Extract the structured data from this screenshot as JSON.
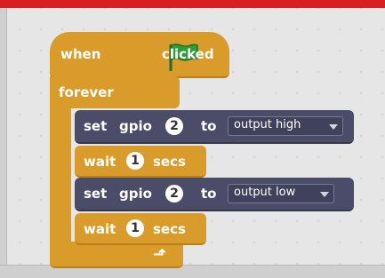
{
  "script": {
    "hat": {
      "when_label": "when",
      "clicked_label": "clicked",
      "flag_icon": "green-flag-icon"
    },
    "forever": {
      "label": "forever",
      "loop_icon": "loop-arrow-icon"
    },
    "blocks": [
      {
        "type": "set_gpio",
        "set_label": "set",
        "gpio_label": "gpio",
        "pin": "2",
        "to_label": "to",
        "mode": "output high"
      },
      {
        "type": "wait",
        "wait_label": "wait",
        "seconds": "1",
        "secs_label": "secs"
      },
      {
        "type": "set_gpio",
        "set_label": "set",
        "gpio_label": "gpio",
        "pin": "2",
        "to_label": "to",
        "mode": "output low"
      },
      {
        "type": "wait",
        "wait_label": "wait",
        "seconds": "1",
        "secs_label": "secs"
      }
    ]
  },
  "colors": {
    "control_block": "#d99b2a",
    "gpio_block": "#4b4c68",
    "flag": "#2e9d3a",
    "top_bar": "#d81e1e"
  }
}
